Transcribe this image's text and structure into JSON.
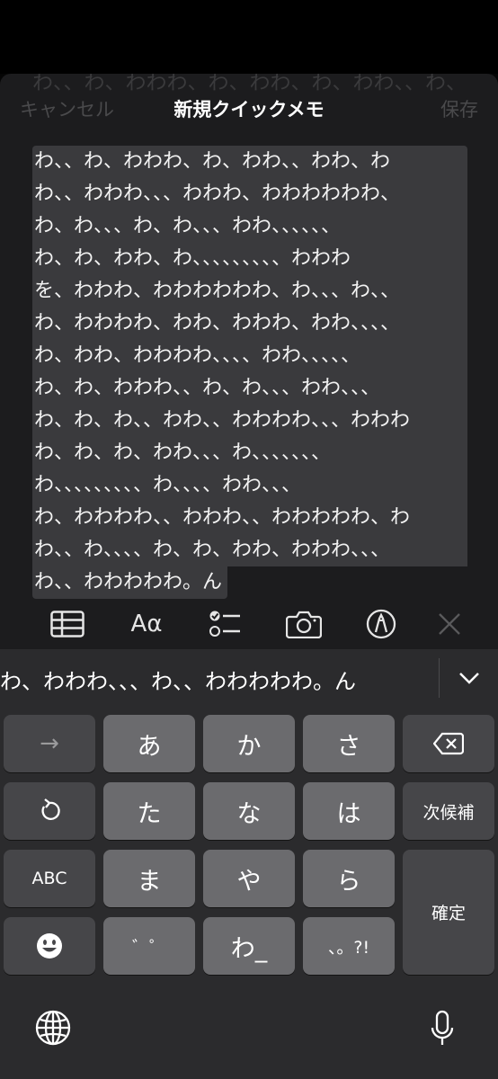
{
  "nav": {
    "cancel_label": "キャンセル",
    "title": "新規クイックメモ",
    "save_label": "保存"
  },
  "ghost_line": "わ、、わ、わわわ、わ、わわ、わ、わわ、、わ、",
  "note_lines": [
    "わ、、わ、わわわ、わ、わわ、、わわ、わ",
    "わ、、わわわ、、、わわわ、わわわわわわ、",
    "わ、わ、、、わ、わ、、、わわ、、、、、、",
    "わ、わ、わわ、わ、、、、、、、、、わわわ",
    "を、わわわ、わわわわわわ、わ、、、わ、、",
    "わ、わわわわ、わわ、わわわ、わわ、、、、",
    "わ、わわ、わわわわ、、、、わわ、、、、、",
    "わ、わ、わわわ、、わ、わ、、、わわ、、、",
    "わ、わ、わ、、わわ、、わわわわ、、、わわわ",
    "わ、わ、わ、わわ、、、わ、、、、、、、",
    "わ、、、、、、、、、わ、、、、わわ、、、",
    "わ、わわわわ、、わわわ、、わわわわわ、わ",
    "わ、、わ、、、、わ、わ、わわ、わわわ、、、",
    "わ、、わわわわわ。ん"
  ],
  "toolbar": {
    "table_icon": "table-icon",
    "format_label": "Aα",
    "checklist_icon": "checklist-icon",
    "camera_icon": "camera-icon",
    "markup_icon": "markup-pen-icon",
    "close_icon": "close-icon"
  },
  "keyboard": {
    "candidate": "わ、わわわ、、、わ、、わわわわわ。ん",
    "keys": {
      "arrow": "→",
      "a": "あ",
      "ka": "か",
      "sa": "さ",
      "ta": "た",
      "na": "な",
      "ha": "は",
      "next_candidate": "次候補",
      "abc": "ABC",
      "ma": "ま",
      "ya": "や",
      "ra": "ら",
      "confirm": "確定",
      "dakuten": "゛゜",
      "wa": "わ_",
      "punct": "、。?!"
    }
  },
  "colors": {
    "sheet": "#1c1c1e",
    "selection": "#3a3a3d",
    "key": "#6b6b6e",
    "func_key": "#464649",
    "keyboard_bg": "#2b2b2d"
  }
}
